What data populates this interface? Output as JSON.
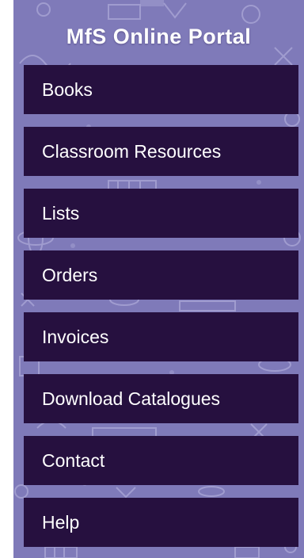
{
  "portal": {
    "title": "MfS Online Portal"
  },
  "menu": {
    "items": [
      {
        "label": "Books"
      },
      {
        "label": "Classroom Resources"
      },
      {
        "label": "Lists"
      },
      {
        "label": "Orders"
      },
      {
        "label": "Invoices"
      },
      {
        "label": "Download Catalogues"
      },
      {
        "label": "Contact"
      },
      {
        "label": "Help"
      }
    ]
  },
  "colors": {
    "panel_background": "#7f7ab9",
    "menu_item_background": "#26103f",
    "text": "#ffffff"
  }
}
